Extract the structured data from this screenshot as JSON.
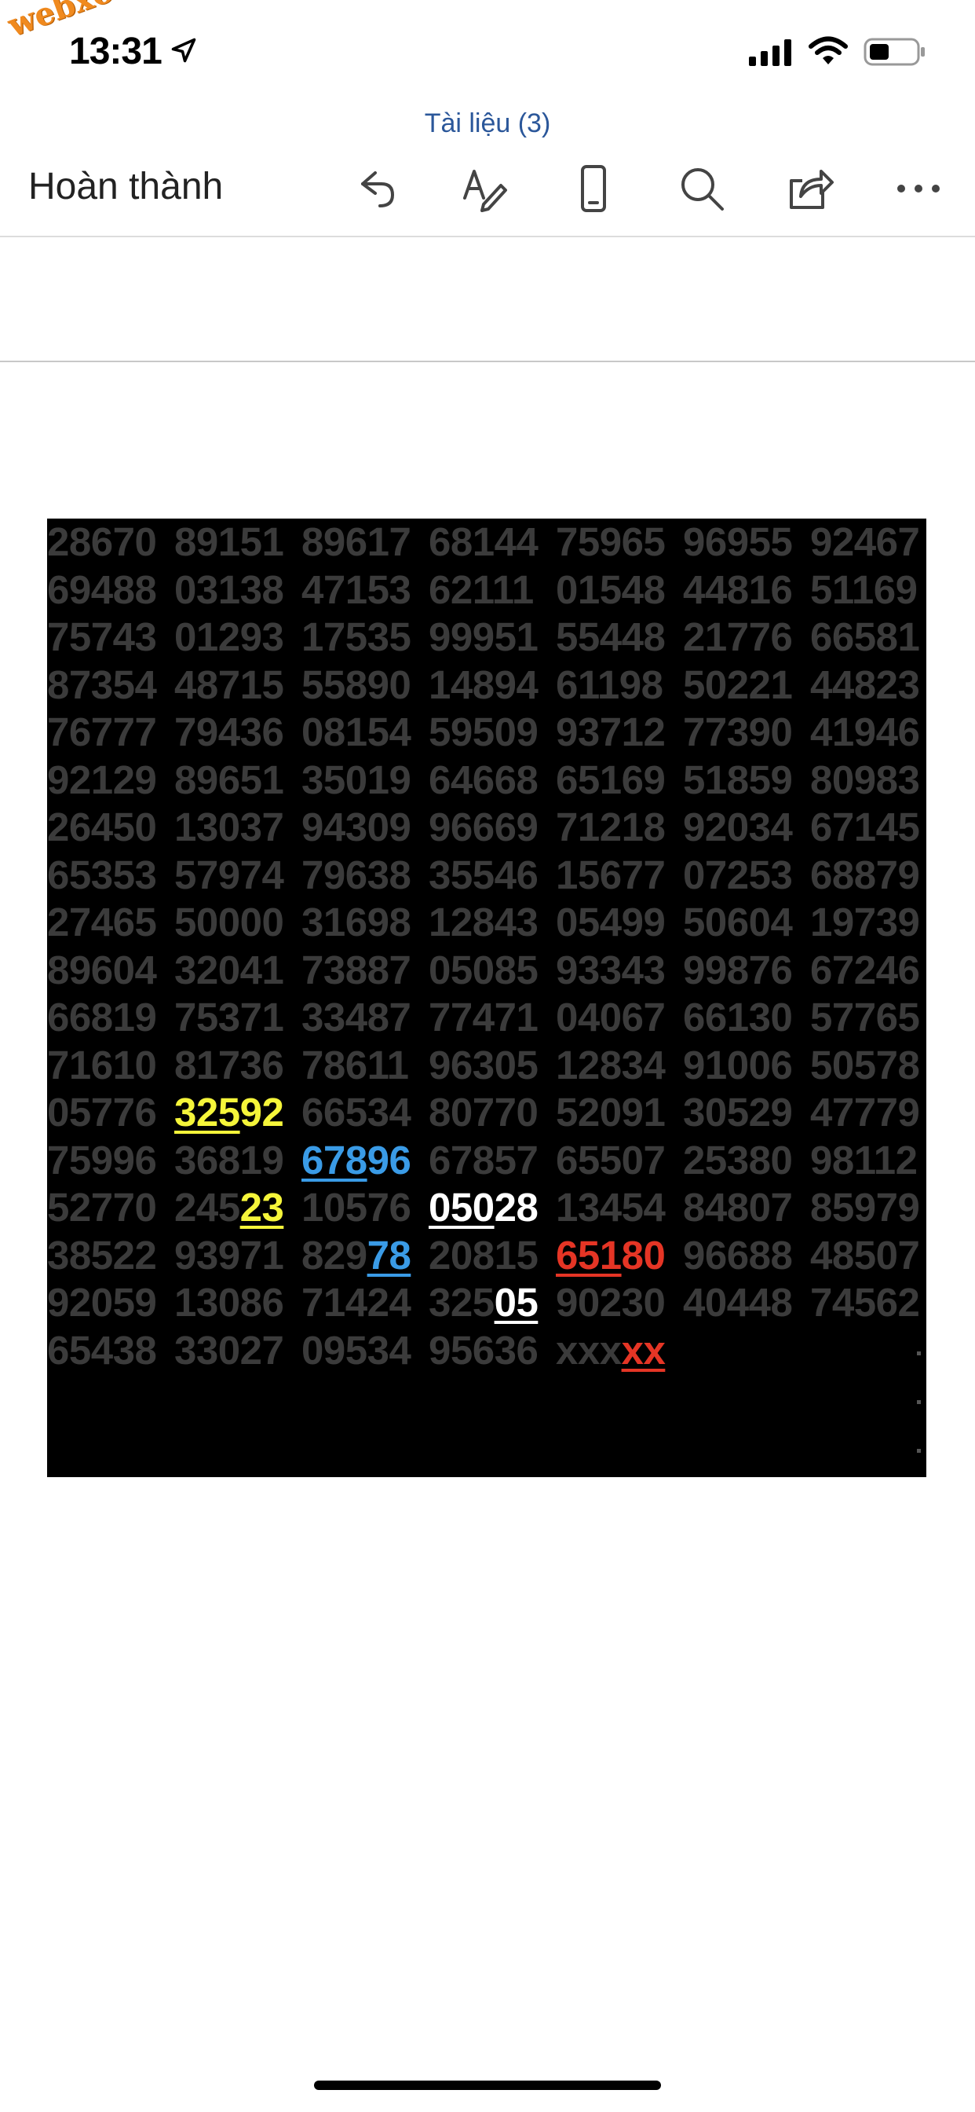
{
  "status_bar": {
    "time": "13:31",
    "watermark": "webxoso.net"
  },
  "document": {
    "title": "Tài liệu (3)",
    "done_label": "Hoàn thành"
  },
  "toolbar": {
    "icons": [
      "undo-icon",
      "draw-icon",
      "mobile-view-icon",
      "search-icon",
      "share-icon",
      "more-icon"
    ]
  },
  "grid": {
    "rows": [
      [
        [
          "28670"
        ],
        [
          "89151"
        ],
        [
          "89617"
        ],
        [
          "68144"
        ],
        [
          "75965"
        ],
        [
          "96955"
        ],
        [
          "92467"
        ]
      ],
      [
        [
          "69488"
        ],
        [
          "03138"
        ],
        [
          "47153"
        ],
        [
          "62111"
        ],
        [
          "01548"
        ],
        [
          "44816"
        ],
        [
          "51169"
        ]
      ],
      [
        [
          "75743"
        ],
        [
          "01293"
        ],
        [
          "17535"
        ],
        [
          "99951"
        ],
        [
          "55448"
        ],
        [
          "21776"
        ],
        [
          "66581"
        ]
      ],
      [
        [
          "87354"
        ],
        [
          "48715"
        ],
        [
          "55890"
        ],
        [
          "14894"
        ],
        [
          "61198"
        ],
        [
          "50221"
        ],
        [
          "44823"
        ]
      ],
      [
        [
          "76777"
        ],
        [
          "79436"
        ],
        [
          "08154"
        ],
        [
          "59509"
        ],
        [
          "93712"
        ],
        [
          "77390"
        ],
        [
          "41946"
        ]
      ],
      [
        [
          "92129"
        ],
        [
          "89651"
        ],
        [
          "35019"
        ],
        [
          "64668"
        ],
        [
          "65169"
        ],
        [
          "51859"
        ],
        [
          "80983"
        ]
      ],
      [
        [
          "26450"
        ],
        [
          "13037"
        ],
        [
          "94309"
        ],
        [
          "96669"
        ],
        [
          "71218"
        ],
        [
          "92034"
        ],
        [
          "67145"
        ]
      ],
      [
        [
          "65353"
        ],
        [
          "57974"
        ],
        [
          "79638"
        ],
        [
          "35546"
        ],
        [
          "15677"
        ],
        [
          "07253"
        ],
        [
          "68879"
        ]
      ],
      [
        [
          "27465"
        ],
        [
          "50000"
        ],
        [
          "31698"
        ],
        [
          "12843"
        ],
        [
          "05499"
        ],
        [
          "50604"
        ],
        [
          "19739"
        ]
      ],
      [
        [
          "89604"
        ],
        [
          "32041"
        ],
        [
          "73887"
        ],
        [
          "05085"
        ],
        [
          "93343"
        ],
        [
          "99876"
        ],
        [
          "67246"
        ]
      ],
      [
        [
          "66819"
        ],
        [
          "75371"
        ],
        [
          "33487"
        ],
        [
          "77471"
        ],
        [
          "04067"
        ],
        [
          "66130"
        ],
        [
          "57765"
        ]
      ],
      [
        [
          "71610"
        ],
        [
          "81736"
        ],
        [
          "78611"
        ],
        [
          "96305"
        ],
        [
          "12834"
        ],
        [
          "91006"
        ],
        [
          "50578"
        ]
      ],
      [
        [
          "05776"
        ],
        [
          [
            "325",
            "yellow",
            true
          ],
          [
            "92",
            "yellow",
            false
          ]
        ],
        [
          "66534"
        ],
        [
          "80770"
        ],
        [
          "52091"
        ],
        [
          "30529"
        ],
        [
          "47779"
        ]
      ],
      [
        [
          "75996"
        ],
        [
          "36819"
        ],
        [
          [
            "678",
            "blue",
            true
          ],
          [
            "96",
            "blue",
            false
          ]
        ],
        [
          "67857"
        ],
        [
          "65507"
        ],
        [
          "25380"
        ],
        [
          "98112"
        ]
      ],
      [
        [
          "52770"
        ],
        [
          [
            "245",
            null,
            false
          ],
          [
            "23",
            "yellow",
            true
          ]
        ],
        [
          "10576"
        ],
        [
          [
            "050",
            "white",
            true
          ],
          [
            "28",
            "white",
            false
          ]
        ],
        [
          "13454"
        ],
        [
          "84807"
        ],
        [
          "85979"
        ]
      ],
      [
        [
          "38522"
        ],
        [
          "93971"
        ],
        [
          [
            "829",
            null,
            false
          ],
          [
            "78",
            "blue",
            true
          ]
        ],
        [
          "20815"
        ],
        [
          [
            "651",
            "red",
            true
          ],
          [
            "80",
            "red",
            false
          ]
        ],
        [
          "96688"
        ],
        [
          "48507"
        ]
      ],
      [
        [
          "92059"
        ],
        [
          "13086"
        ],
        [
          "71424"
        ],
        [
          [
            "325",
            null,
            false
          ],
          [
            "05",
            "white",
            true
          ]
        ],
        [
          "90230"
        ],
        [
          "40448"
        ],
        [
          "74562"
        ]
      ],
      [
        [
          "65438"
        ],
        [
          "33027"
        ],
        [
          "09534"
        ],
        [
          "95636"
        ],
        [
          [
            "xxx",
            null,
            false
          ],
          [
            "xx",
            "red",
            true
          ]
        ]
      ]
    ]
  }
}
